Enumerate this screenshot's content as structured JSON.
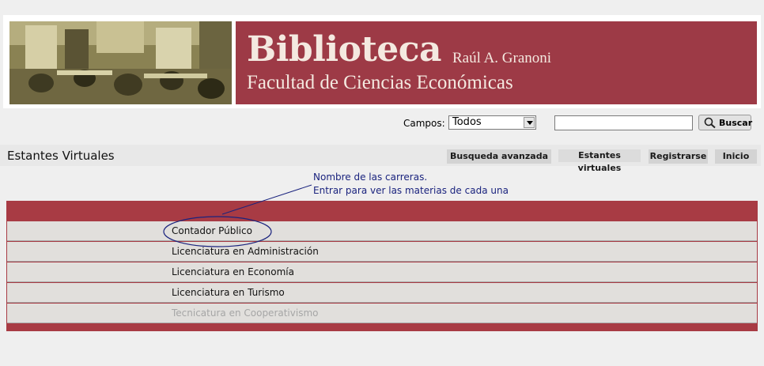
{
  "header": {
    "title": "Biblioteca",
    "subtitle": "Raúl A. Granoni",
    "faculty": "Facultad de Ciencias Económicas"
  },
  "search": {
    "campos_label": "Campos:",
    "selected_field": "Todos",
    "query": "",
    "button_label": "Buscar"
  },
  "page": {
    "title": "Estantes Virtuales"
  },
  "nav": [
    {
      "label": "Busqueda avanzada"
    },
    {
      "label": "Estantes virtuales"
    },
    {
      "label": "Registrarse"
    },
    {
      "label": "Inicio"
    }
  ],
  "annotation": {
    "line1": "Nombre de las carreras.",
    "line2": "Entrar para ver las materias de cada una",
    "color": "#1a237e"
  },
  "careers": [
    {
      "label": "Contador Público",
      "enabled": true
    },
    {
      "label": "Licenciatura en Administración",
      "enabled": true
    },
    {
      "label": "Licenciatura en Economía",
      "enabled": true
    },
    {
      "label": "Licenciatura en Turismo",
      "enabled": true
    },
    {
      "label": "Tecnicatura en Cooperativismo",
      "enabled": false
    }
  ],
  "colors": {
    "brand": "#9d3a46",
    "list_header": "#a83b44",
    "row_bg": "#e1dfdc"
  }
}
